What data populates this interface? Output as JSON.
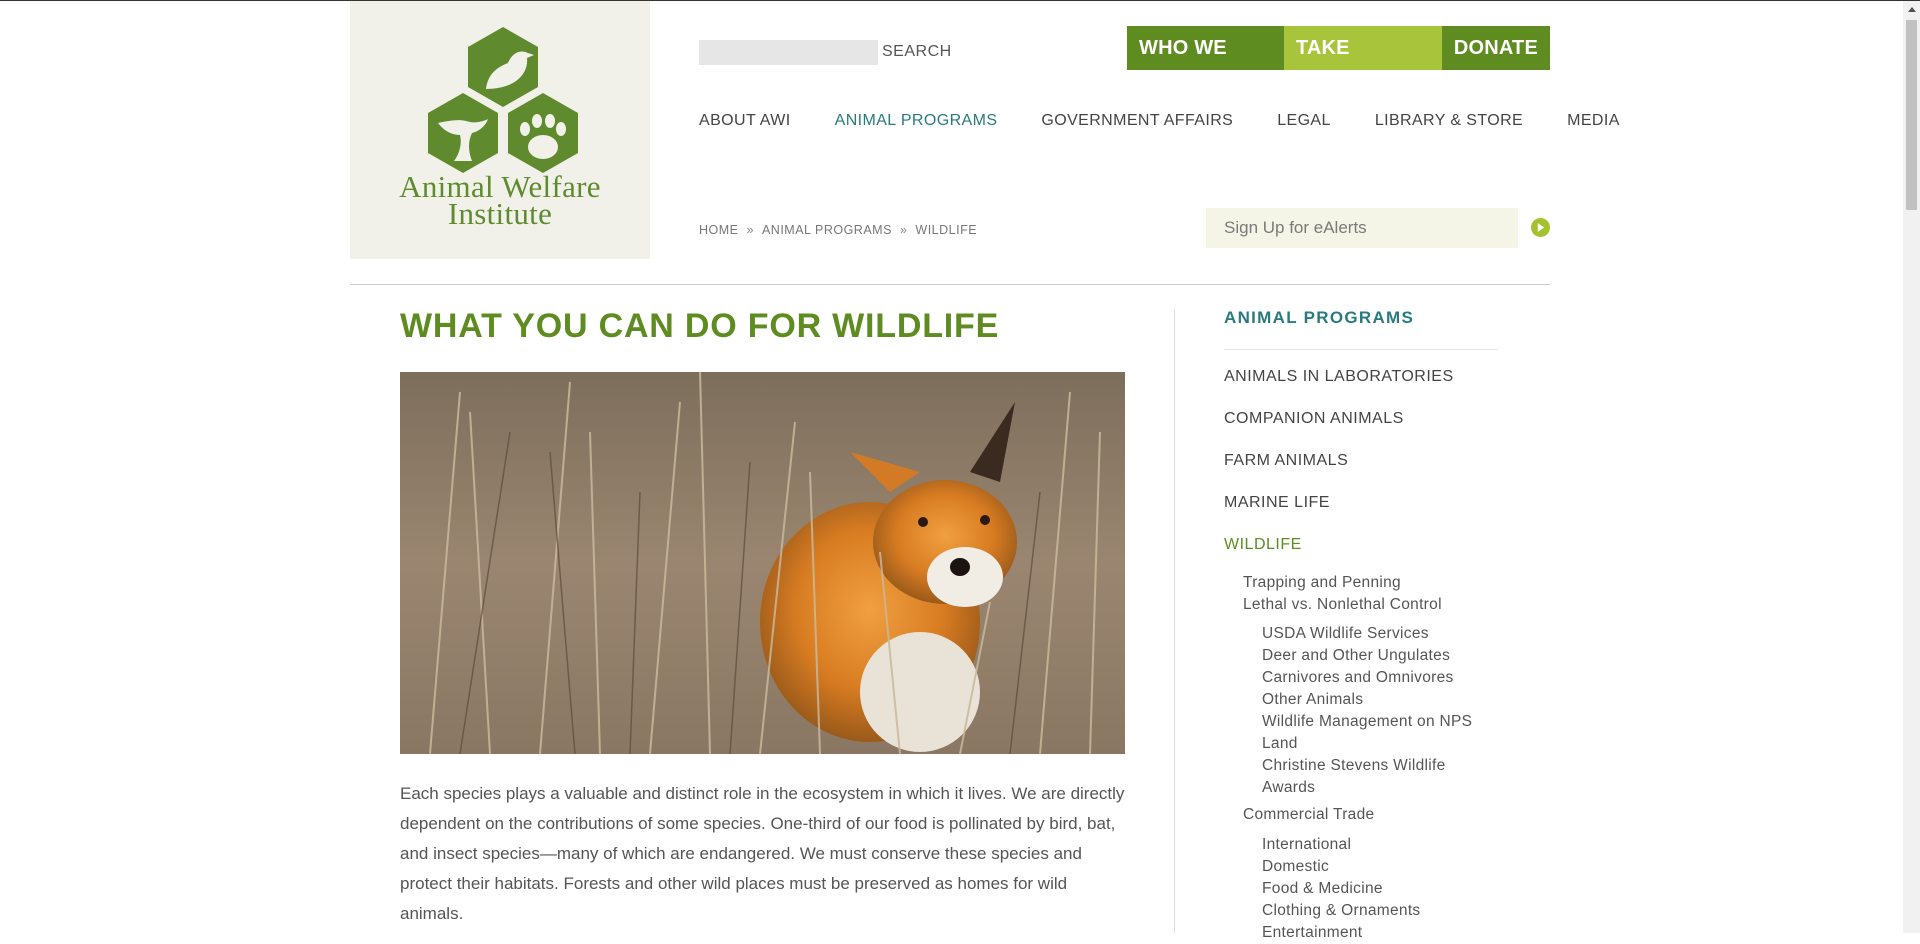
{
  "logo": {
    "line1": "Animal Welfare",
    "line2": "Institute"
  },
  "search": {
    "placeholder": "",
    "button_label": "SEARCH"
  },
  "actions": {
    "who_we_are": "WHO WE ARE",
    "take_action": "TAKE ACTION",
    "donate": "DONATE"
  },
  "nav": {
    "items": [
      "ABOUT AWI",
      "ANIMAL PROGRAMS",
      "GOVERNMENT AFFAIRS",
      "LEGAL",
      "LIBRARY & STORE",
      "MEDIA"
    ],
    "active": "ANIMAL PROGRAMS"
  },
  "breadcrumb": {
    "items": [
      "HOME",
      "ANIMAL PROGRAMS",
      "WILDLIFE"
    ],
    "separator": "»"
  },
  "ealerts": {
    "placeholder": "Sign Up for eAlerts"
  },
  "main": {
    "title": "WHAT YOU CAN DO FOR WILDLIFE",
    "intro": "Each species plays a valuable and distinct role in the ecosystem in which it lives. We are directly dependent on the contributions of some species. One-third of our food is pollinated by bird, bat, and insect species—many of which are endangered. We must conserve these species and protect their habitats. Forests and other wild places must be preserved as homes for wild animals."
  },
  "sidebar": {
    "title": "ANIMAL PROGRAMS",
    "items": [
      "ANIMALS IN LABORATORIES",
      "COMPANION ANIMALS",
      "FARM ANIMALS",
      "MARINE LIFE",
      "WILDLIFE"
    ],
    "active": "WILDLIFE",
    "wildlife_sub": [
      "Trapping and Penning",
      "Lethal vs. Nonlethal Control"
    ],
    "lethal_sub": [
      "USDA Wildlife Services",
      "Deer and Other Ungulates",
      "Carnivores and Omnivores",
      "Other Animals",
      "Wildlife Management on NPS Land",
      "Christine Stevens Wildlife Awards"
    ],
    "commercial": "Commercial Trade",
    "commercial_sub": [
      "International",
      "Domestic",
      "Food & Medicine",
      "Clothing & Ornaments",
      "Entertainment"
    ]
  },
  "colors": {
    "brand_green": "#5e8c21",
    "light_green": "#a8c43a",
    "teal": "#2a7b80",
    "logo_bg": "#f1f1ea"
  },
  "icons": {
    "logo": "awi-hexagon-logo-icon",
    "go": "arrow-right-circle-icon",
    "scroll_up": "scroll-up-arrow-icon"
  }
}
